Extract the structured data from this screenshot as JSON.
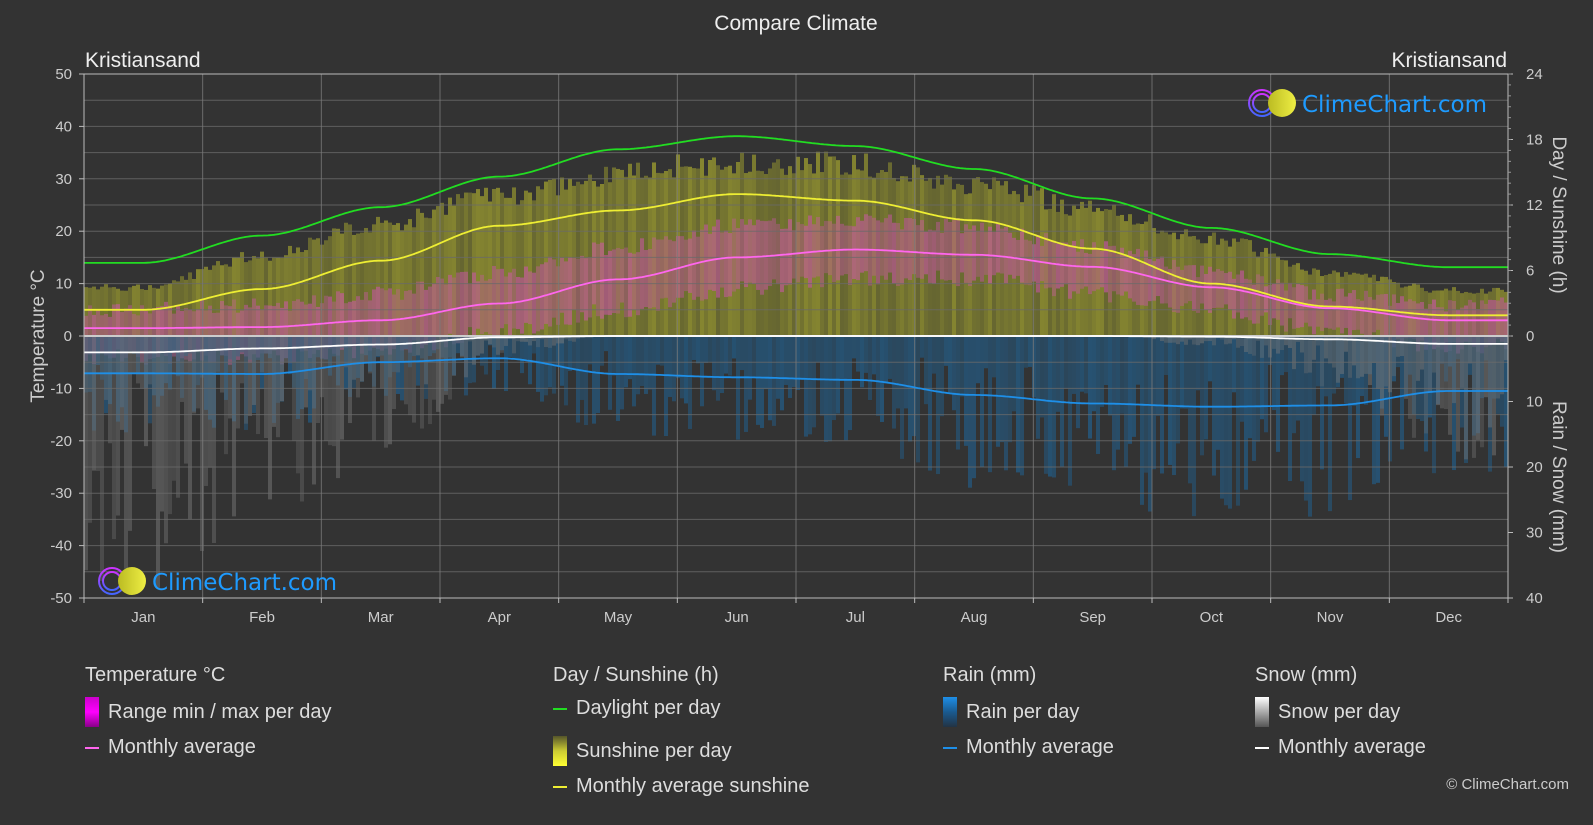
{
  "title": "Compare Climate",
  "location_left": "Kristiansand",
  "location_right": "Kristiansand",
  "watermark": "ClimeChart.com",
  "copyright": "© ClimeChart.com",
  "colors": {
    "background": "#333333",
    "grid": "#5a5a5a",
    "daylight": "#22dd22",
    "sunshine_avg": "#eeee33",
    "sunshine_fill": "#8f8f30",
    "temp_avg": "#ff66ee",
    "temp_range": "#cc55aa",
    "rain_avg": "#1e8fe8",
    "rain_fill": "#245a82",
    "snow_avg": "#ffffff",
    "snow_fill": "#777777",
    "logo_text": "#1e9bff"
  },
  "chart_data": {
    "type": "line",
    "title": "Compare Climate",
    "categories": [
      "Jan",
      "Feb",
      "Mar",
      "Apr",
      "May",
      "Jun",
      "Jul",
      "Aug",
      "Sep",
      "Oct",
      "Nov",
      "Dec"
    ],
    "left_axis": {
      "label": "Temperature °C",
      "range": [
        -50,
        50
      ],
      "ticks": [
        50,
        40,
        30,
        20,
        10,
        0,
        -10,
        -20,
        -30,
        -40,
        -50
      ]
    },
    "right_axis_top": {
      "label": "Day / Sunshine (h)",
      "range": [
        0,
        24
      ],
      "ticks": [
        24,
        18,
        12,
        6,
        0
      ]
    },
    "right_axis_bottom": {
      "label": "Rain / Snow (mm)",
      "range": [
        0,
        40
      ],
      "ticks": [
        0,
        10,
        20,
        30,
        40
      ]
    },
    "grid": true,
    "series": [
      {
        "name": "Daylight per day",
        "axis": "sunshine_h",
        "values": [
          6.7,
          9.2,
          11.8,
          14.6,
          17.1,
          18.3,
          17.4,
          15.3,
          12.6,
          9.9,
          7.5,
          6.3
        ]
      },
      {
        "name": "Monthly average sunshine",
        "axis": "sunshine_h",
        "values": [
          2.4,
          4.3,
          6.9,
          10.1,
          11.5,
          13.0,
          12.4,
          10.6,
          8.0,
          4.8,
          2.7,
          1.9
        ]
      },
      {
        "name": "Temperature monthly average",
        "axis": "temp_c",
        "values": [
          1.5,
          1.7,
          3.0,
          6.2,
          10.8,
          15.0,
          16.5,
          15.5,
          13.2,
          9.3,
          5.3,
          3.0
        ]
      },
      {
        "name": "Rain monthly average",
        "axis": "precip_mm",
        "values": [
          5.7,
          5.8,
          4.0,
          3.4,
          5.8,
          6.3,
          6.7,
          9.0,
          10.3,
          10.8,
          10.6,
          8.4
        ]
      },
      {
        "name": "Snow monthly average",
        "axis": "precip_mm",
        "values": [
          2.5,
          1.9,
          1.3,
          0.2,
          0.0,
          0.0,
          0.0,
          0.0,
          0.0,
          0.1,
          0.5,
          1.2
        ]
      },
      {
        "name": "Sunshine per day (top of band)",
        "axis": "sunshine_h",
        "values": [
          4.6,
          7.6,
          10.5,
          13.2,
          15.3,
          16.4,
          16.2,
          14.4,
          12.0,
          9.2,
          5.9,
          4.3
        ]
      },
      {
        "name": "Temperature range max (approx)",
        "axis": "temp_c",
        "values": [
          5,
          6,
          8,
          12,
          17,
          21,
          22,
          21,
          17,
          12,
          8,
          6
        ]
      },
      {
        "name": "Temperature range min (approx)",
        "axis": "temp_c",
        "values": [
          -4,
          -4,
          -3,
          1,
          5,
          9,
          11,
          11,
          8,
          5,
          1,
          -2
        ]
      }
    ]
  },
  "legend": {
    "groups": [
      {
        "title": "Temperature °C",
        "items": [
          {
            "label": "Range min / max per day",
            "swatch": "box",
            "gradient": [
              "#cc00cc",
              "#ff00ff",
              "#880088"
            ]
          },
          {
            "label": "Monthly average",
            "swatch": "line",
            "color": "#ff66ee"
          }
        ]
      },
      {
        "title": "Day / Sunshine (h)",
        "items": [
          {
            "label": "Daylight per day",
            "swatch": "line",
            "color": "#22dd22"
          },
          {
            "label": "Sunshine per day",
            "swatch": "box",
            "gradient": [
              "#55552a",
              "#cccc33",
              "#ffff33"
            ]
          },
          {
            "label": "Monthly average sunshine",
            "swatch": "line",
            "color": "#eeee33"
          }
        ]
      },
      {
        "title": "Rain (mm)",
        "items": [
          {
            "label": "Rain per day",
            "swatch": "box",
            "gradient": [
              "#1e8fe8",
              "#1a5a90",
              "#223344"
            ]
          },
          {
            "label": "Monthly average",
            "swatch": "line",
            "color": "#1e8fe8"
          }
        ]
      },
      {
        "title": "Snow (mm)",
        "items": [
          {
            "label": "Snow per day",
            "swatch": "box",
            "gradient": [
              "#ffffff",
              "#aaaaaa",
              "#555555"
            ]
          },
          {
            "label": "Monthly average",
            "swatch": "line",
            "color": "#ffffff"
          }
        ]
      }
    ]
  }
}
